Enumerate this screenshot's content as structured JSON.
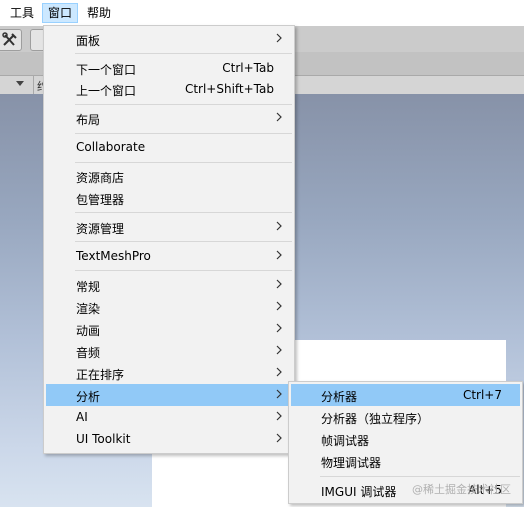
{
  "menubar": {
    "items": [
      {
        "label": "工具"
      },
      {
        "label": "窗口"
      },
      {
        "label": "帮助"
      }
    ]
  },
  "scene_tab": {
    "partial_label": "约"
  },
  "window_menu": {
    "items": [
      {
        "label": "面板",
        "shortcut": "",
        "submenu": true
      },
      {
        "label": "下一个窗口",
        "shortcut": "Ctrl+Tab",
        "submenu": false
      },
      {
        "label": "上一个窗口",
        "shortcut": "Ctrl+Shift+Tab",
        "submenu": false
      },
      {
        "label": "布局",
        "shortcut": "",
        "submenu": true
      },
      {
        "label": "Collaborate",
        "shortcut": "",
        "submenu": false
      },
      {
        "label": "资源商店",
        "shortcut": "",
        "submenu": false
      },
      {
        "label": "包管理器",
        "shortcut": "",
        "submenu": false
      },
      {
        "label": "资源管理",
        "shortcut": "",
        "submenu": true
      },
      {
        "label": "TextMeshPro",
        "shortcut": "",
        "submenu": true
      },
      {
        "label": "常规",
        "shortcut": "",
        "submenu": true
      },
      {
        "label": "渲染",
        "shortcut": "",
        "submenu": true
      },
      {
        "label": "动画",
        "shortcut": "",
        "submenu": true
      },
      {
        "label": "音频",
        "shortcut": "",
        "submenu": true
      },
      {
        "label": "正在排序",
        "shortcut": "",
        "submenu": true
      },
      {
        "label": "分析",
        "shortcut": "",
        "submenu": true
      },
      {
        "label": "AI",
        "shortcut": "",
        "submenu": true
      },
      {
        "label": "UI Toolkit",
        "shortcut": "",
        "submenu": true
      }
    ]
  },
  "analysis_submenu": {
    "items": [
      {
        "label": "分析器",
        "shortcut": "Ctrl+7"
      },
      {
        "label": "分析器（独立程序）",
        "shortcut": ""
      },
      {
        "label": "帧调试器",
        "shortcut": ""
      },
      {
        "label": "物理调试器",
        "shortcut": ""
      },
      {
        "label": "IMGUI 调试器",
        "shortcut": "Alt+5"
      }
    ]
  },
  "watermark": "@稀土掘金技术社区",
  "colors": {
    "highlight": "#91c9f7",
    "menu_bg": "#f2f2f2",
    "menubar_active": "#cce8ff"
  },
  "icons": {
    "chevron": "chevron-right-icon",
    "toolbar_tool": "tools-icon"
  }
}
